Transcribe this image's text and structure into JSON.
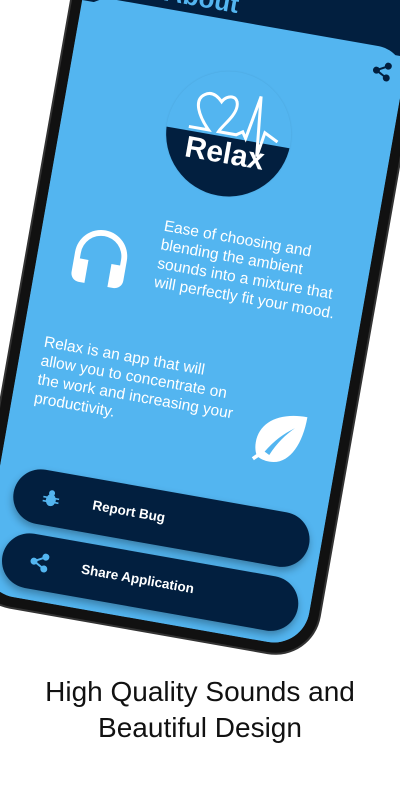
{
  "header": {
    "back_icon": "chevron-left-icon",
    "title": "About",
    "share_icon": "share-icon"
  },
  "logo": {
    "text": "Relax"
  },
  "features": [
    {
      "icon": "headphones-icon",
      "text": "Ease of choosing and blending the ambient sounds into a mixture that will perfectly fit your mood."
    },
    {
      "icon": "leaf-icon",
      "text": "Relax is an app that will allow you to concentrate on the work and increasing your productivity."
    }
  ],
  "buttons": [
    {
      "icon": "bug-icon",
      "label": "Report Bug"
    },
    {
      "icon": "share-icon",
      "label": "Share Application"
    }
  ],
  "caption": "High Quality Sounds and Beautiful Design",
  "colors": {
    "accent": "#53b5f0",
    "navy": "#021f3f"
  }
}
